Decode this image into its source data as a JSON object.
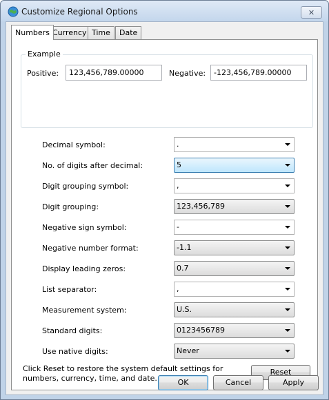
{
  "window": {
    "title": "Customize Regional Options",
    "close_label": "✕"
  },
  "tabs": [
    {
      "label": "Numbers",
      "active": true
    },
    {
      "label": "Currency"
    },
    {
      "label": "Time"
    },
    {
      "label": "Date"
    }
  ],
  "example": {
    "legend": "Example",
    "positive_label": "Positive:",
    "positive_value": "123,456,789.00000",
    "negative_label": "Negative:",
    "negative_value": "-123,456,789.00000"
  },
  "settings": [
    {
      "label": "Decimal symbol:",
      "value": "."
    },
    {
      "label": "No. of digits after decimal:",
      "value": "5"
    },
    {
      "label": "Digit grouping symbol:",
      "value": ","
    },
    {
      "label": "Digit grouping:",
      "value": "123,456,789"
    },
    {
      "label": "Negative sign symbol:",
      "value": "-"
    },
    {
      "label": "Negative number format:",
      "value": "-1.1"
    },
    {
      "label": "Display leading zeros:",
      "value": "0.7"
    },
    {
      "label": "List separator:",
      "value": ","
    },
    {
      "label": "Measurement system:",
      "value": "U.S."
    },
    {
      "label": "Standard digits:",
      "value": "0123456789"
    },
    {
      "label": "Use native digits:",
      "value": "Never"
    }
  ],
  "reset_note": "Click Reset to restore the system default settings for numbers, currency, time, and date.",
  "buttons": {
    "reset": "Reset",
    "ok": "OK",
    "cancel": "Cancel",
    "apply": "Apply"
  }
}
